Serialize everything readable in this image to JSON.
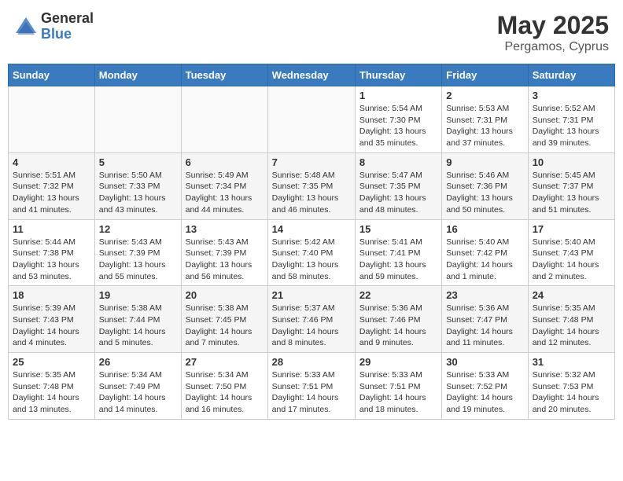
{
  "header": {
    "logo_general": "General",
    "logo_blue": "Blue",
    "month_year": "May 2025",
    "location": "Pergamos, Cyprus"
  },
  "days_of_week": [
    "Sunday",
    "Monday",
    "Tuesday",
    "Wednesday",
    "Thursday",
    "Friday",
    "Saturday"
  ],
  "weeks": [
    [
      {
        "day": "",
        "info": ""
      },
      {
        "day": "",
        "info": ""
      },
      {
        "day": "",
        "info": ""
      },
      {
        "day": "",
        "info": ""
      },
      {
        "day": "1",
        "info": "Sunrise: 5:54 AM\nSunset: 7:30 PM\nDaylight: 13 hours\nand 35 minutes."
      },
      {
        "day": "2",
        "info": "Sunrise: 5:53 AM\nSunset: 7:31 PM\nDaylight: 13 hours\nand 37 minutes."
      },
      {
        "day": "3",
        "info": "Sunrise: 5:52 AM\nSunset: 7:31 PM\nDaylight: 13 hours\nand 39 minutes."
      }
    ],
    [
      {
        "day": "4",
        "info": "Sunrise: 5:51 AM\nSunset: 7:32 PM\nDaylight: 13 hours\nand 41 minutes."
      },
      {
        "day": "5",
        "info": "Sunrise: 5:50 AM\nSunset: 7:33 PM\nDaylight: 13 hours\nand 43 minutes."
      },
      {
        "day": "6",
        "info": "Sunrise: 5:49 AM\nSunset: 7:34 PM\nDaylight: 13 hours\nand 44 minutes."
      },
      {
        "day": "7",
        "info": "Sunrise: 5:48 AM\nSunset: 7:35 PM\nDaylight: 13 hours\nand 46 minutes."
      },
      {
        "day": "8",
        "info": "Sunrise: 5:47 AM\nSunset: 7:35 PM\nDaylight: 13 hours\nand 48 minutes."
      },
      {
        "day": "9",
        "info": "Sunrise: 5:46 AM\nSunset: 7:36 PM\nDaylight: 13 hours\nand 50 minutes."
      },
      {
        "day": "10",
        "info": "Sunrise: 5:45 AM\nSunset: 7:37 PM\nDaylight: 13 hours\nand 51 minutes."
      }
    ],
    [
      {
        "day": "11",
        "info": "Sunrise: 5:44 AM\nSunset: 7:38 PM\nDaylight: 13 hours\nand 53 minutes."
      },
      {
        "day": "12",
        "info": "Sunrise: 5:43 AM\nSunset: 7:39 PM\nDaylight: 13 hours\nand 55 minutes."
      },
      {
        "day": "13",
        "info": "Sunrise: 5:43 AM\nSunset: 7:39 PM\nDaylight: 13 hours\nand 56 minutes."
      },
      {
        "day": "14",
        "info": "Sunrise: 5:42 AM\nSunset: 7:40 PM\nDaylight: 13 hours\nand 58 minutes."
      },
      {
        "day": "15",
        "info": "Sunrise: 5:41 AM\nSunset: 7:41 PM\nDaylight: 13 hours\nand 59 minutes."
      },
      {
        "day": "16",
        "info": "Sunrise: 5:40 AM\nSunset: 7:42 PM\nDaylight: 14 hours\nand 1 minute."
      },
      {
        "day": "17",
        "info": "Sunrise: 5:40 AM\nSunset: 7:43 PM\nDaylight: 14 hours\nand 2 minutes."
      }
    ],
    [
      {
        "day": "18",
        "info": "Sunrise: 5:39 AM\nSunset: 7:43 PM\nDaylight: 14 hours\nand 4 minutes."
      },
      {
        "day": "19",
        "info": "Sunrise: 5:38 AM\nSunset: 7:44 PM\nDaylight: 14 hours\nand 5 minutes."
      },
      {
        "day": "20",
        "info": "Sunrise: 5:38 AM\nSunset: 7:45 PM\nDaylight: 14 hours\nand 7 minutes."
      },
      {
        "day": "21",
        "info": "Sunrise: 5:37 AM\nSunset: 7:46 PM\nDaylight: 14 hours\nand 8 minutes."
      },
      {
        "day": "22",
        "info": "Sunrise: 5:36 AM\nSunset: 7:46 PM\nDaylight: 14 hours\nand 9 minutes."
      },
      {
        "day": "23",
        "info": "Sunrise: 5:36 AM\nSunset: 7:47 PM\nDaylight: 14 hours\nand 11 minutes."
      },
      {
        "day": "24",
        "info": "Sunrise: 5:35 AM\nSunset: 7:48 PM\nDaylight: 14 hours\nand 12 minutes."
      }
    ],
    [
      {
        "day": "25",
        "info": "Sunrise: 5:35 AM\nSunset: 7:48 PM\nDaylight: 14 hours\nand 13 minutes."
      },
      {
        "day": "26",
        "info": "Sunrise: 5:34 AM\nSunset: 7:49 PM\nDaylight: 14 hours\nand 14 minutes."
      },
      {
        "day": "27",
        "info": "Sunrise: 5:34 AM\nSunset: 7:50 PM\nDaylight: 14 hours\nand 16 minutes."
      },
      {
        "day": "28",
        "info": "Sunrise: 5:33 AM\nSunset: 7:51 PM\nDaylight: 14 hours\nand 17 minutes."
      },
      {
        "day": "29",
        "info": "Sunrise: 5:33 AM\nSunset: 7:51 PM\nDaylight: 14 hours\nand 18 minutes."
      },
      {
        "day": "30",
        "info": "Sunrise: 5:33 AM\nSunset: 7:52 PM\nDaylight: 14 hours\nand 19 minutes."
      },
      {
        "day": "31",
        "info": "Sunrise: 5:32 AM\nSunset: 7:53 PM\nDaylight: 14 hours\nand 20 minutes."
      }
    ]
  ]
}
